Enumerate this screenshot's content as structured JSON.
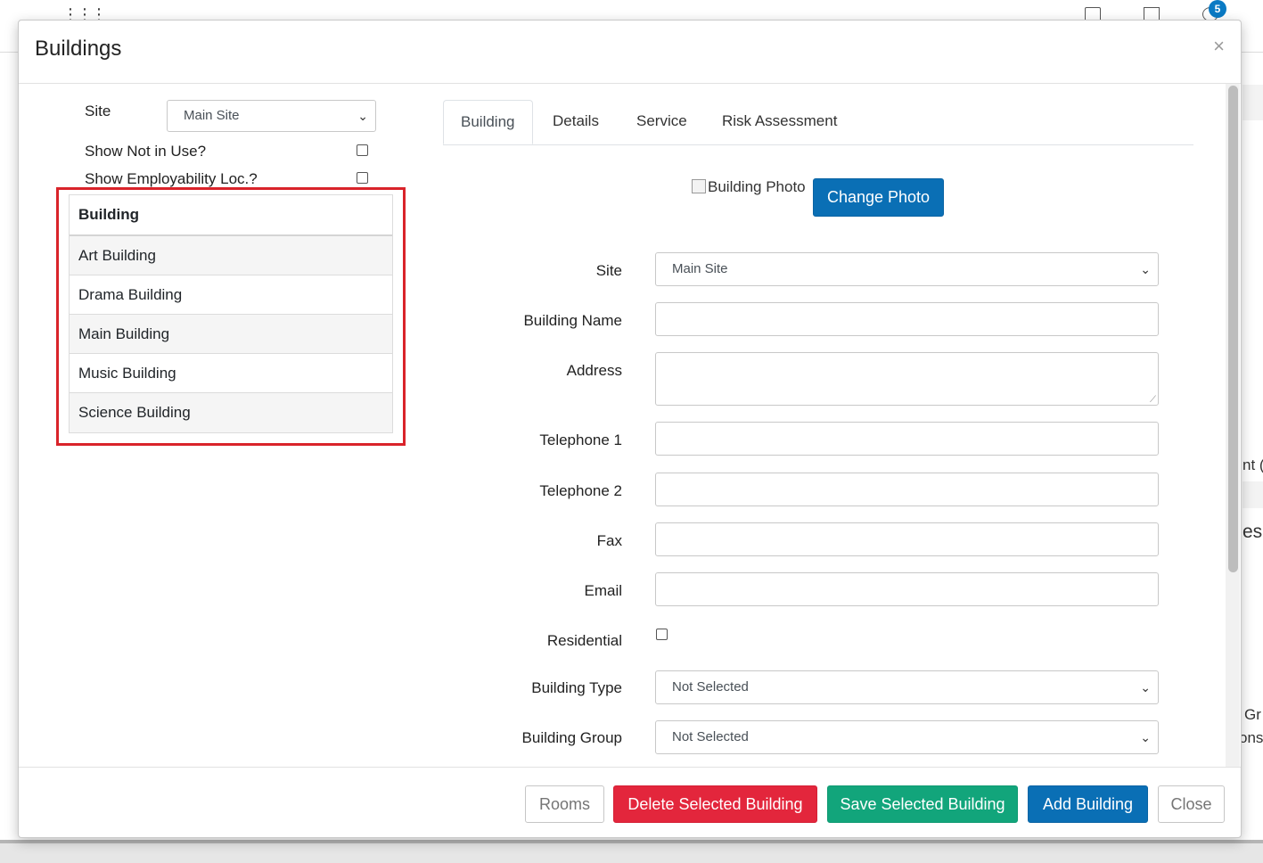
{
  "background": {
    "notification_count": "5",
    "side_fragments": [
      "nt (C",
      "es",
      "Gr",
      "ons"
    ]
  },
  "modal": {
    "title": "Buildings",
    "close_symbol": "×"
  },
  "filters": {
    "site_label": "Site",
    "site_value": "Main Site",
    "show_not_in_use_label": "Show Not in Use?",
    "show_not_in_use_checked": false,
    "show_employability_label": "Show Employability Loc.?",
    "show_employability_checked": false
  },
  "building_list": {
    "header": "Building",
    "items": [
      "Art Building",
      "Drama Building",
      "Main Building",
      "Music Building",
      "Science Building"
    ]
  },
  "tabs": [
    "Building",
    "Details",
    "Service",
    "Risk Assessment"
  ],
  "active_tab": "Building",
  "photo": {
    "alt_text": "Building Photo",
    "change_label": "Change Photo"
  },
  "form": {
    "site_label": "Site",
    "site_value": "Main Site",
    "building_name_label": "Building Name",
    "building_name_value": "",
    "address_label": "Address",
    "address_value": "",
    "telephone1_label": "Telephone 1",
    "telephone1_value": "",
    "telephone2_label": "Telephone 2",
    "telephone2_value": "",
    "fax_label": "Fax",
    "fax_value": "",
    "email_label": "Email",
    "email_value": "",
    "residential_label": "Residential",
    "residential_checked": false,
    "building_type_label": "Building Type",
    "building_type_value": "Not Selected",
    "building_group_label": "Building Group",
    "building_group_value": "Not Selected",
    "in_use_checked": true
  },
  "footer": {
    "rooms_label": "Rooms",
    "delete_label": "Delete Selected Building",
    "save_label": "Save Selected Building",
    "add_label": "Add Building",
    "close_label": "Close"
  },
  "colors": {
    "primary": "#0a6fb5",
    "danger": "#e3263c",
    "success": "#12a57b",
    "highlight": "#d9232a"
  }
}
